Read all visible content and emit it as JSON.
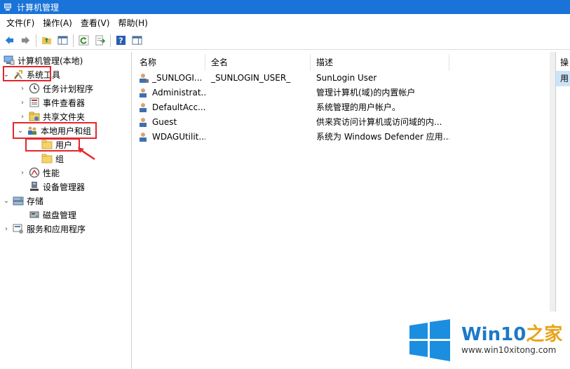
{
  "window": {
    "title": "计算机管理"
  },
  "menubar": {
    "items": [
      "文件(F)",
      "操作(A)",
      "查看(V)",
      "帮助(H)"
    ]
  },
  "toolbar": {
    "icons": [
      "back-arrow-icon",
      "forward-arrow-icon",
      "up-folder-icon",
      "show-hide-tree-icon",
      "refresh-icon",
      "export-list-icon",
      "help-icon",
      "properties-icon"
    ]
  },
  "tree": {
    "root": "计算机管理(本地)",
    "system_tools": "系统工具",
    "task_scheduler": "任务计划程序",
    "event_viewer": "事件查看器",
    "shared_folders": "共享文件夹",
    "local_users_groups": "本地用户和组",
    "users": "用户",
    "groups": "组",
    "performance": "性能",
    "device_manager": "设备管理器",
    "storage": "存储",
    "disk_management": "磁盘管理",
    "services_apps": "服务和应用程序"
  },
  "list": {
    "columns": {
      "name": "名称",
      "fullname": "全名",
      "description": "描述"
    },
    "rows": [
      {
        "name": "_SUNLOGI...",
        "fullname": "_SUNLOGIN_USER_",
        "description": "SunLogin User"
      },
      {
        "name": "Administrat...",
        "fullname": "",
        "description": "管理计算机(域)的内置帐户"
      },
      {
        "name": "DefaultAcc...",
        "fullname": "",
        "description": "系统管理的用户帐户。"
      },
      {
        "name": "Guest",
        "fullname": "",
        "description": "供来宾访问计算机或访问域的内..."
      },
      {
        "name": "WDAGUtilit...",
        "fullname": "",
        "description": "系统为 Windows Defender 应用..."
      }
    ]
  },
  "actions": {
    "header": "操",
    "item": "用"
  },
  "watermark": {
    "brand_main": "Win10",
    "brand_accent": "之家",
    "url": "www.win10xitong.com"
  },
  "colors": {
    "titlebar": "#1a73d8",
    "highlight": "#e5262d",
    "selection": "#cce4f7",
    "folder": "#f5d36b"
  }
}
